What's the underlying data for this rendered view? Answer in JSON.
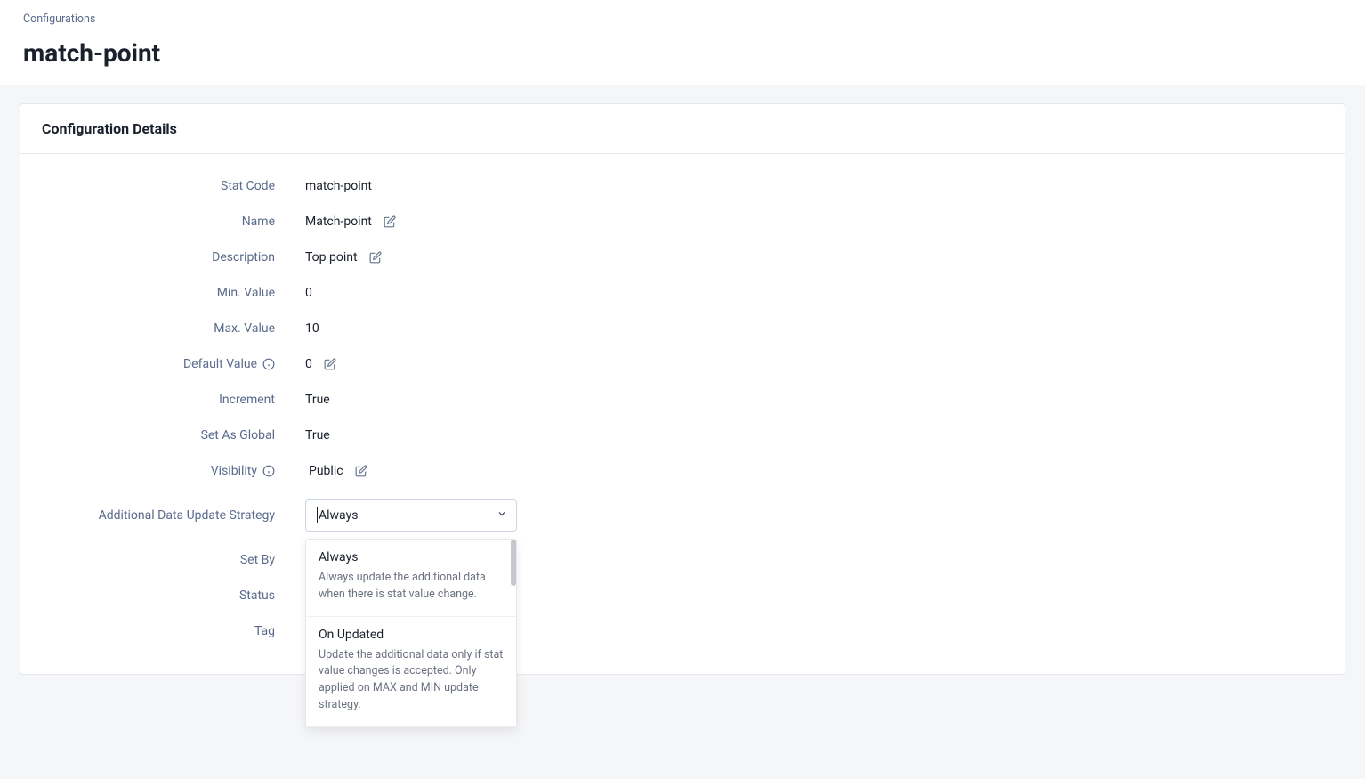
{
  "breadcrumb": {
    "label": "Configurations"
  },
  "page": {
    "title": "match-point"
  },
  "card": {
    "title": "Configuration Details"
  },
  "fields": {
    "statCode": {
      "label": "Stat Code",
      "value": "match-point"
    },
    "name": {
      "label": "Name",
      "value": "Match-point"
    },
    "description": {
      "label": "Description",
      "value": "Top point"
    },
    "minValue": {
      "label": "Min. Value",
      "value": "0"
    },
    "maxValue": {
      "label": "Max. Value",
      "value": "10"
    },
    "defaultValue": {
      "label": "Default Value",
      "value": "0"
    },
    "increment": {
      "label": "Increment",
      "value": "True"
    },
    "setAsGlobal": {
      "label": "Set As Global",
      "value": "True"
    },
    "visibility": {
      "label": "Visibility",
      "value": "Public"
    },
    "updateStrategy": {
      "label": "Additional Data Update Strategy",
      "selected": "Always"
    },
    "setBy": {
      "label": "Set By"
    },
    "status": {
      "label": "Status"
    },
    "tag": {
      "label": "Tag"
    }
  },
  "dropdown": {
    "options": [
      {
        "title": "Always",
        "desc": "Always update the additional data when there is stat value change."
      },
      {
        "title": "On Updated",
        "desc": "Update the additional data only if stat value changes is accepted. Only applied on MAX and MIN update strategy."
      }
    ]
  }
}
